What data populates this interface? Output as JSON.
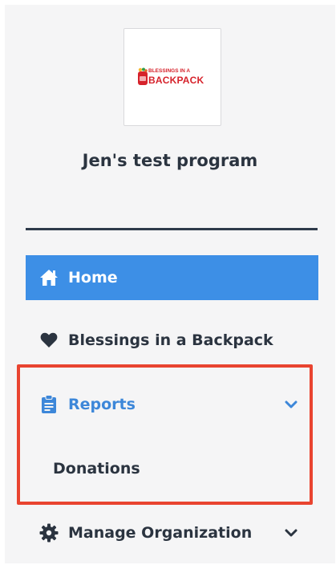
{
  "logo": {
    "line1": "Blessings in a",
    "line2": "Backpack",
    "icon": "backpack-logo-icon",
    "color": "#d6222b"
  },
  "program_name": "Jen's test program",
  "nav": {
    "home": {
      "label": "Home",
      "icon": "home-icon",
      "active": true
    },
    "blessings": {
      "label": "Blessings in a Backpack",
      "icon": "heart-icon"
    },
    "reports": {
      "label": "Reports",
      "icon": "clipboard-icon",
      "expanded": true,
      "chevron": "chevron-down-icon"
    },
    "donations": {
      "label": "Donations"
    },
    "manage": {
      "label": "Manage Organization",
      "icon": "gear-icon",
      "chevron": "chevron-down-icon"
    }
  },
  "colors": {
    "active_bg": "#3d8fe6",
    "reports_text": "#3d87d9",
    "highlight": "#e94430",
    "text_dark": "#2b3440"
  }
}
